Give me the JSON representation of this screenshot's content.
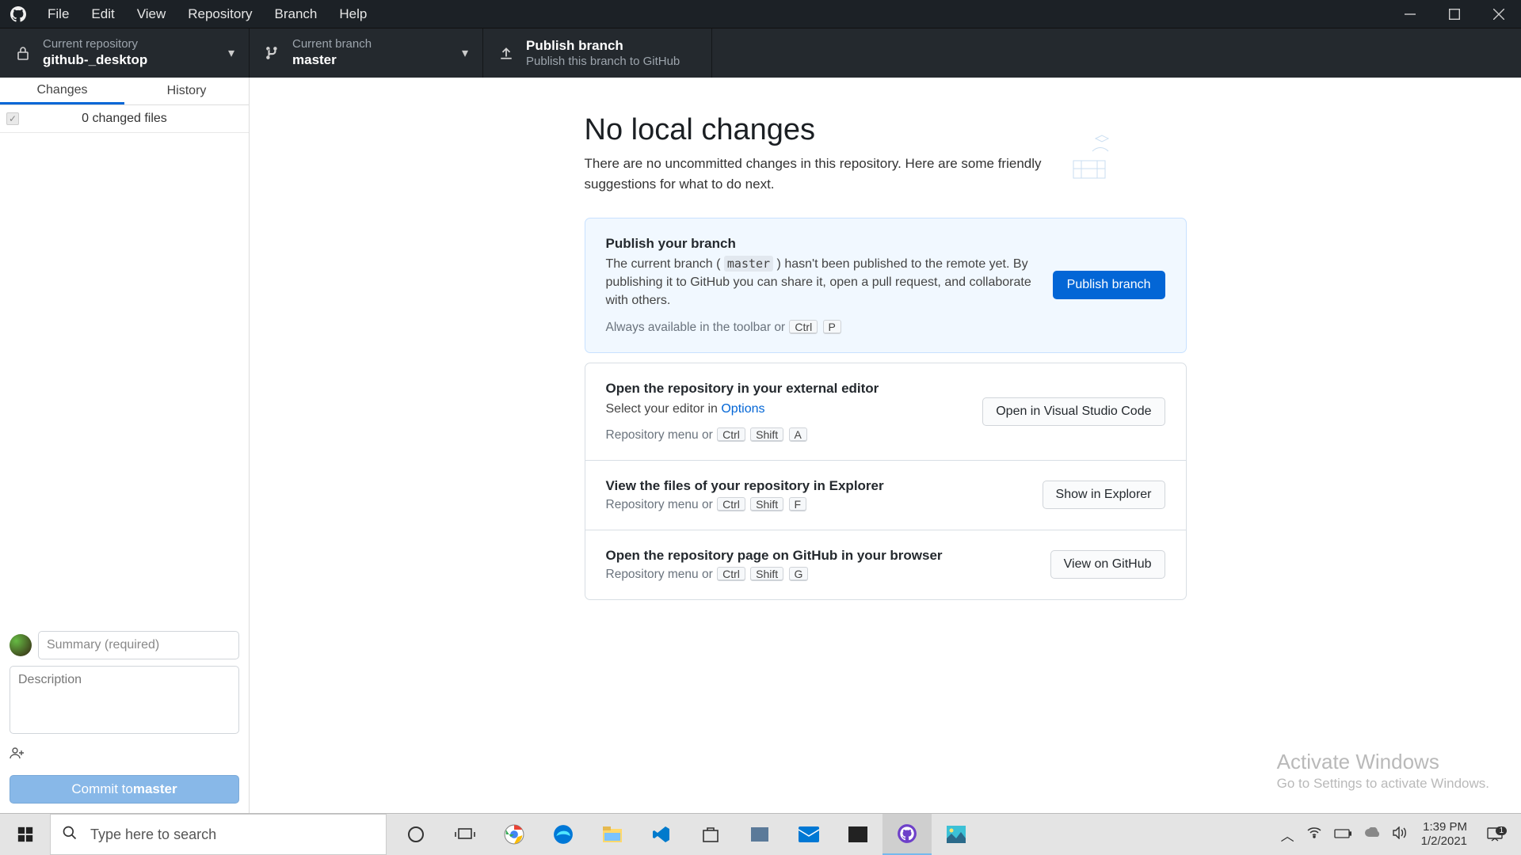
{
  "menubar": {
    "items": [
      "File",
      "Edit",
      "View",
      "Repository",
      "Branch",
      "Help"
    ]
  },
  "toolbar": {
    "repo": {
      "label": "Current repository",
      "value": "github-_desktop"
    },
    "branch": {
      "label": "Current branch",
      "value": "master"
    },
    "publish": {
      "label": "Publish branch",
      "sub": "Publish this branch to GitHub"
    }
  },
  "sidebar": {
    "tabs": {
      "changes": "Changes",
      "history": "History"
    },
    "changed_files": "0 changed files",
    "summary_placeholder": "Summary (required)",
    "description_placeholder": "Description",
    "commit_prefix": "Commit to ",
    "commit_branch": "master"
  },
  "main": {
    "heading": "No local changes",
    "subheading": "There are no uncommitted changes in this repository. Here are some friendly suggestions for what to do next.",
    "cards": {
      "publish": {
        "title": "Publish your branch",
        "desc_pre": "The current branch ( ",
        "desc_code": "master",
        "desc_post": " ) hasn't been published to the remote yet. By publishing it to GitHub you can share it, open a pull request, and collaborate with others.",
        "hint_text": "Always available in the toolbar or",
        "hint_keys": [
          "Ctrl",
          "P"
        ],
        "button": "Publish branch"
      },
      "editor": {
        "title": "Open the repository in your external editor",
        "desc": "Select your editor in ",
        "link": "Options",
        "hint_text": "Repository menu or",
        "hint_keys": [
          "Ctrl",
          "Shift",
          "A"
        ],
        "button": "Open in Visual Studio Code"
      },
      "explorer": {
        "title": "View the files of your repository in Explorer",
        "hint_text": "Repository menu or",
        "hint_keys": [
          "Ctrl",
          "Shift",
          "F"
        ],
        "button": "Show in Explorer"
      },
      "github": {
        "title": "Open the repository page on GitHub in your browser",
        "hint_text": "Repository menu or",
        "hint_keys": [
          "Ctrl",
          "Shift",
          "G"
        ],
        "button": "View on GitHub"
      }
    }
  },
  "watermark": {
    "line1": "Activate Windows",
    "line2": "Go to Settings to activate Windows."
  },
  "taskbar": {
    "search_placeholder": "Type here to search",
    "time": "1:39 PM",
    "date": "1/2/2021",
    "notif_count": "1"
  }
}
